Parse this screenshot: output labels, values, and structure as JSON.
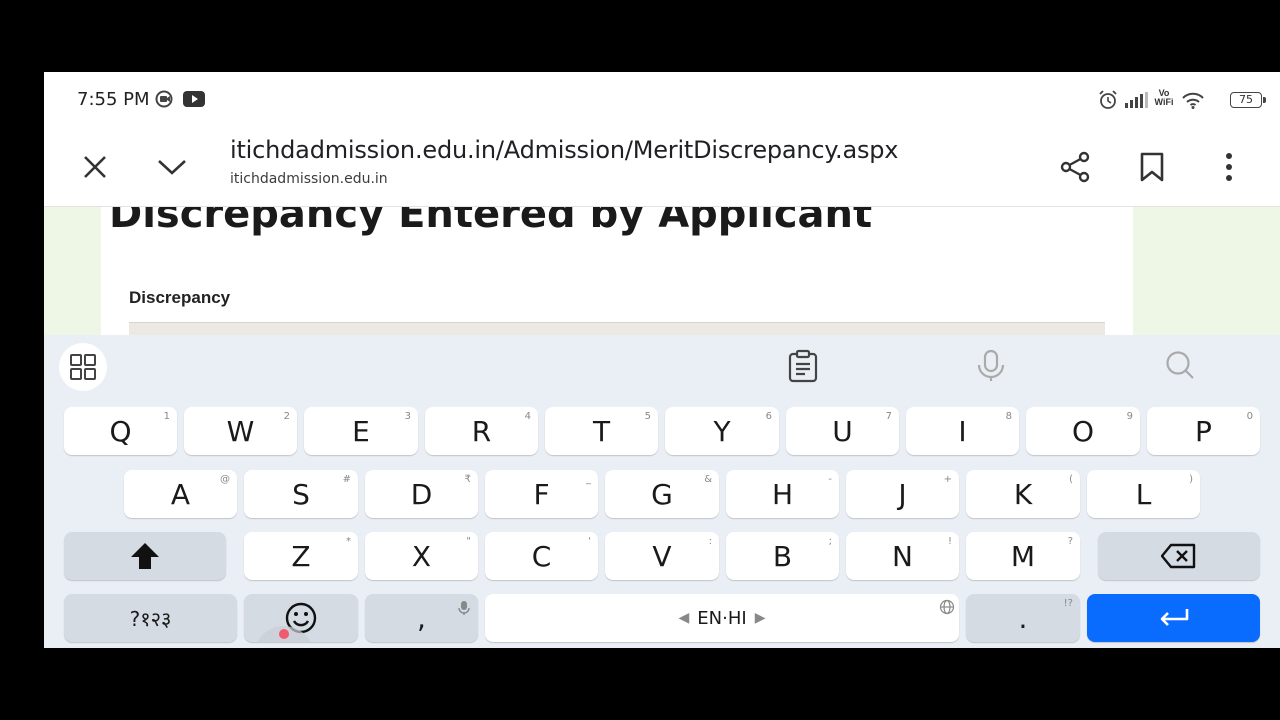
{
  "status_bar": {
    "time": "7:55 PM",
    "battery": "75",
    "icons": [
      "screen-record-icon",
      "youtube-icon",
      "alarm-icon",
      "signal-icon",
      "vowifi-icon",
      "wifi-icon",
      "battery-icon"
    ],
    "vowifi_text_top": "Vo",
    "vowifi_text_bottom": "WiFi"
  },
  "browser": {
    "url": "itichdadmission.edu.in/Admission/MeritDiscrepancy.aspx",
    "domain": "itichdadmission.edu.in"
  },
  "page": {
    "heading": "Discrepancy Entered by Applicant",
    "field_label": "Discrepancy"
  },
  "keyboard": {
    "row1": [
      {
        "label": "Q",
        "hint": "1"
      },
      {
        "label": "W",
        "hint": "2"
      },
      {
        "label": "E",
        "hint": "3"
      },
      {
        "label": "R",
        "hint": "4"
      },
      {
        "label": "T",
        "hint": "5"
      },
      {
        "label": "Y",
        "hint": "6"
      },
      {
        "label": "U",
        "hint": "7"
      },
      {
        "label": "I",
        "hint": "8"
      },
      {
        "label": "O",
        "hint": "9"
      },
      {
        "label": "P",
        "hint": "0"
      }
    ],
    "row2": [
      {
        "label": "A",
        "hint": "@"
      },
      {
        "label": "S",
        "hint": "#"
      },
      {
        "label": "D",
        "hint": "₹"
      },
      {
        "label": "F",
        "hint": "_"
      },
      {
        "label": "G",
        "hint": "&"
      },
      {
        "label": "H",
        "hint": "-"
      },
      {
        "label": "J",
        "hint": "+"
      },
      {
        "label": "K",
        "hint": "("
      },
      {
        "label": "L",
        "hint": ")"
      }
    ],
    "row3": [
      {
        "label": "Z",
        "hint": "*"
      },
      {
        "label": "X",
        "hint": "\""
      },
      {
        "label": "C",
        "hint": "'"
      },
      {
        "label": "V",
        "hint": ":"
      },
      {
        "label": "B",
        "hint": ";"
      },
      {
        "label": "N",
        "hint": "!"
      },
      {
        "label": "M",
        "hint": "?"
      }
    ],
    "symbols_label": "?१२३",
    "comma_label": ",",
    "space_label": "EN·HI",
    "period_label": ".",
    "period_hint": "!?",
    "accent_color": "#0a6cff"
  }
}
